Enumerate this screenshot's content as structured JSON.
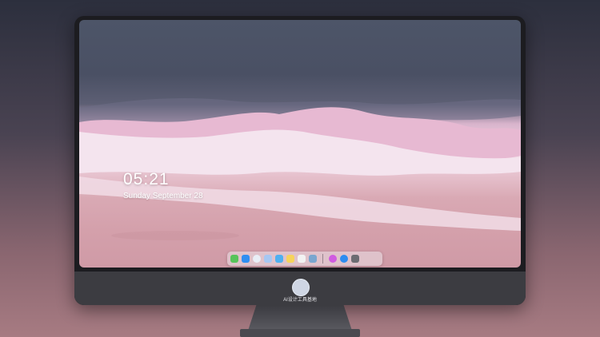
{
  "lockscreen": {
    "time": "05:21",
    "date": "Sunday September 28"
  },
  "dock": {
    "icons": [
      {
        "name": "messages-icon",
        "color": "#57c35a"
      },
      {
        "name": "mail-icon",
        "color": "#2f8ef1"
      },
      {
        "name": "safari-icon",
        "color": "#e9eef6"
      },
      {
        "name": "photos-icon",
        "color": "#a7c7f2"
      },
      {
        "name": "finder-icon",
        "color": "#4fb0f0"
      },
      {
        "name": "notes-icon",
        "color": "#f6d35b"
      },
      {
        "name": "calendar-icon",
        "color": "#f2f2f2"
      },
      {
        "name": "preview-icon",
        "color": "#7aa6cf"
      },
      {
        "name": "itunes-icon",
        "color": "#d05be0"
      },
      {
        "name": "app-store-icon",
        "color": "#2d8cf0"
      },
      {
        "name": "camera-icon",
        "color": "#6c6c72"
      }
    ]
  },
  "monitor": {
    "brand_label": "AI设计工具基地"
  }
}
